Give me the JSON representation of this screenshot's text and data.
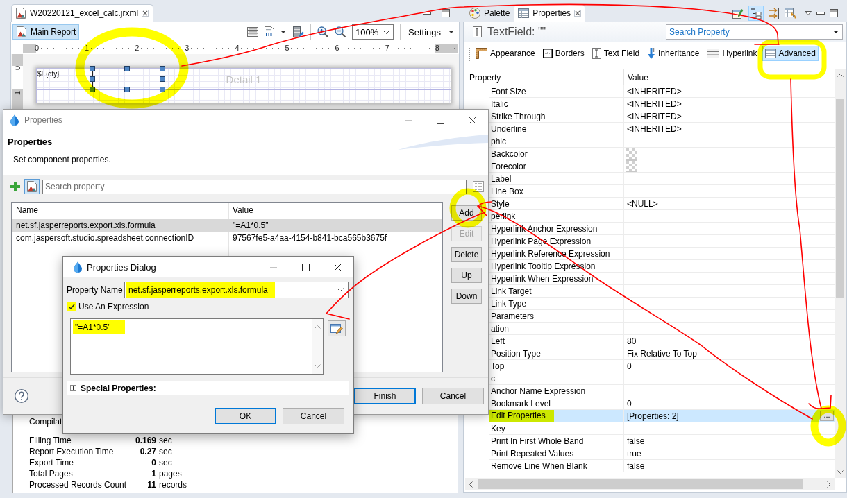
{
  "editor": {
    "tab": {
      "title": "W20220121_excel_calc.jrxml"
    },
    "toolbar": {
      "report_button": {
        "label": "Main Report",
        "selected": true
      },
      "zoom": "100%",
      "settings": "Settings"
    },
    "ruler": [
      "0",
      "1",
      "2",
      "3",
      "4",
      "5",
      "6",
      "7",
      "8"
    ],
    "vertical_ruler": [
      "0",
      "1"
    ],
    "band": {
      "label": "Detail 1",
      "elements": [
        {
          "kind": "text_field",
          "expression": "$F{qty}",
          "selected": false
        },
        {
          "kind": "text_field",
          "selected": true
        }
      ]
    }
  },
  "stats": [
    {
      "label": "Compilat"
    },
    {
      "label": "Filling Time",
      "value": "0.169",
      "unit": "sec"
    },
    {
      "label": "Report Execution Time",
      "value": "0.27",
      "unit": "sec"
    },
    {
      "label": "Export Time",
      "value": "0",
      "unit": "sec"
    },
    {
      "label": "Total Pages",
      "value": "1",
      "unit": "pages"
    },
    {
      "label": "Processed Records Count",
      "value": "11",
      "unit": "records"
    }
  ],
  "properties_view": {
    "tabs": [
      {
        "label": "Palette",
        "kind": "palette",
        "selected": false
      },
      {
        "label": "Properties",
        "kind": "properties",
        "selected": true
      }
    ],
    "toolbar": [
      {
        "kind": "new",
        "selected": false
      },
      {
        "kind": "tree",
        "selected": true
      },
      {
        "kind": "arrows",
        "selected": false
      },
      {
        "kind": "table",
        "selected": false
      }
    ],
    "title": "TextField: \"\"",
    "search": {
      "placeholder": "Search Property"
    },
    "sections": [
      {
        "label": "Appearance",
        "kind": "appearance",
        "selected": false
      },
      {
        "label": "Borders",
        "kind": "borders",
        "selected": false
      },
      {
        "label": "Text Field",
        "kind": "text_field",
        "selected": false
      },
      {
        "label": "Inheritance",
        "kind": "inheritance",
        "selected": false
      },
      {
        "label": "Hyperlink",
        "kind": "hyperlink",
        "selected": false
      },
      {
        "label": "Advanced",
        "kind": "advanced",
        "selected": true
      }
    ],
    "columns": [
      "Property",
      "Value"
    ],
    "rows": [
      {
        "name": "Font Size",
        "kind": "text",
        "value": "<INHERITED>",
        "selected": false,
        "highlighted": false
      },
      {
        "name": "Italic",
        "kind": "text",
        "value": "<INHERITED>",
        "selected": false,
        "highlighted": false
      },
      {
        "name": "Strike Through",
        "kind": "text",
        "value": "<INHERITED>",
        "selected": false,
        "highlighted": false
      },
      {
        "name": "Underline",
        "kind": "text",
        "value": "<INHERITED>",
        "selected": false,
        "highlighted": false
      },
      {
        "name": "phic",
        "kind": "text",
        "selected": false,
        "highlighted": false
      },
      {
        "name": "Backcolor",
        "kind": "color",
        "selected": false,
        "highlighted": false
      },
      {
        "name": "Forecolor",
        "kind": "color",
        "selected": false,
        "highlighted": false
      },
      {
        "name": "Label",
        "kind": "text",
        "selected": false,
        "highlighted": false
      },
      {
        "name": "Line Box",
        "kind": "text",
        "selected": false,
        "highlighted": false
      },
      {
        "name": "Style",
        "kind": "text",
        "value": "<NULL>",
        "selected": false,
        "highlighted": false
      },
      {
        "name": "perlink",
        "kind": "text",
        "selected": false,
        "highlighted": false
      },
      {
        "name": "Hyperlink Anchor Expression",
        "kind": "text",
        "selected": false,
        "highlighted": false
      },
      {
        "name": "Hyperlink Page Expression",
        "kind": "text",
        "selected": false,
        "highlighted": false
      },
      {
        "name": "Hyperlink Reference Expression",
        "kind": "text",
        "selected": false,
        "highlighted": false
      },
      {
        "name": "Hyperlink Tooltip Expression",
        "kind": "text",
        "selected": false,
        "highlighted": false
      },
      {
        "name": "Hyperlink When Expression",
        "kind": "text",
        "selected": false,
        "highlighted": false
      },
      {
        "name": "Link Target",
        "kind": "text",
        "selected": false,
        "highlighted": false
      },
      {
        "name": "Link Type",
        "kind": "text",
        "selected": false,
        "highlighted": false
      },
      {
        "name": "Parameters",
        "kind": "text",
        "selected": false,
        "highlighted": false
      },
      {
        "name": "ation",
        "kind": "text",
        "selected": false,
        "highlighted": false
      },
      {
        "name": "Left",
        "kind": "text",
        "value": "80",
        "selected": false,
        "highlighted": false
      },
      {
        "name": "Position Type",
        "kind": "text",
        "value": "Fix Relative To Top",
        "selected": false,
        "highlighted": false
      },
      {
        "name": "Top",
        "kind": "text",
        "value": "0",
        "selected": false,
        "highlighted": false
      },
      {
        "name": "c",
        "kind": "text",
        "selected": false,
        "highlighted": false
      },
      {
        "name": "Anchor Name Expression",
        "kind": "text",
        "selected": false,
        "highlighted": false
      },
      {
        "name": "Bookmark Level",
        "kind": "text",
        "value": "0",
        "selected": false,
        "highlighted": false
      },
      {
        "name": "Edit Properties",
        "kind": "dialog",
        "value": "[Properties: 2]",
        "button": "...",
        "selected": true,
        "highlighted": true
      },
      {
        "name": "Key",
        "kind": "text",
        "selected": false,
        "highlighted": false
      },
      {
        "name": "Print In First Whole Band",
        "kind": "text",
        "value": "false",
        "selected": false,
        "highlighted": false
      },
      {
        "name": "Print Repeated Values",
        "kind": "text",
        "value": "true",
        "selected": false,
        "highlighted": false
      },
      {
        "name": "Remove Line When Blank",
        "kind": "text",
        "value": "false",
        "selected": false,
        "highlighted": false
      }
    ]
  },
  "wizard": {
    "title": "Properties",
    "heading": "Properties",
    "description": "Set component properties.",
    "image_toggle": {
      "selected": true
    },
    "search": {
      "placeholder": "Search property"
    },
    "columns": [
      "Name",
      "Value"
    ],
    "rows": [
      {
        "name": "net.sf.jasperreports.export.xls.formula",
        "value": "\"=A1*0.5\"",
        "selected": true
      },
      {
        "name": "com.jaspersoft.studio.spreadsheet.connectionID",
        "value": "97567fe5-a4aa-4154-b841-bca565b3675f",
        "selected": false
      }
    ],
    "side_buttons": [
      {
        "label": "Add",
        "disabled": false
      },
      {
        "label": "Edit",
        "disabled": true
      },
      {
        "label": "Delete",
        "disabled": false
      },
      {
        "label": "Up",
        "disabled": false
      },
      {
        "label": "Down",
        "disabled": false
      }
    ],
    "buttons": [
      {
        "label": "Finish",
        "default": true
      },
      {
        "label": "Cancel",
        "default": false
      }
    ]
  },
  "dialog": {
    "title": "Properties Dialog",
    "property_name": {
      "label": "Property Name",
      "value": "net.sf.jasperreports.export.xls.formula",
      "highlighted": true
    },
    "use_expression": {
      "label": "Use An Expression",
      "checked": true,
      "highlighted": true
    },
    "expression": {
      "value": "\"=A1*0.5\"",
      "highlighted": true
    },
    "special_properties": {
      "label": "Special Properties:",
      "expanded": false
    },
    "buttons": [
      {
        "label": "OK",
        "default": true
      },
      {
        "label": "Cancel",
        "default": false
      }
    ]
  }
}
